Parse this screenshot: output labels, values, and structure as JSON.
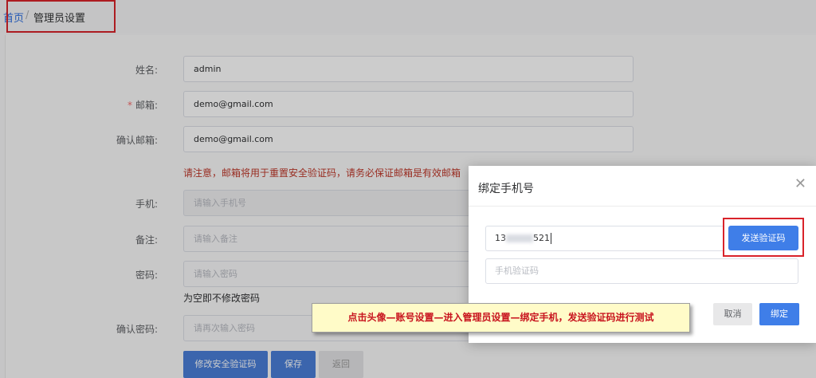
{
  "breadcrumb": {
    "home": "首页",
    "separator": "/",
    "current": "管理员设置"
  },
  "form": {
    "name_label": "姓名:",
    "name_value": "admin",
    "email_star": "*",
    "email_label": "邮箱:",
    "email_value": "demo@gmail.com",
    "confirm_email_label": "确认邮箱:",
    "confirm_email_value": "demo@gmail.com",
    "email_notice": "请注意，邮箱将用于重置安全验证码，请务必保证邮箱是有效邮箱",
    "phone_label": "手机:",
    "phone_placeholder": "请输入手机号",
    "remark_label": "备注:",
    "remark_placeholder": "请输入备注",
    "password_label": "密码:",
    "password_placeholder": "请输入密码",
    "password_hint": "为空即不修改密码",
    "confirm_password_label": "确认密码:",
    "confirm_password_placeholder": "请再次输入密码",
    "buttons": {
      "change_code": "修改安全验证码",
      "save": "保存",
      "back": "返回"
    }
  },
  "dialog": {
    "title": "绑定手机号",
    "close_icon": "close-icon",
    "phone_prefix": "13",
    "phone_suffix": "521",
    "send_code": "发送验证码",
    "code_placeholder": "手机验证码",
    "cancel": "取消",
    "confirm": "绑定"
  },
  "annotation": "点击头像—账号设置—进入管理员设置—绑定手机，发送验证码进行测试",
  "colors": {
    "primary": "#3f7ee8",
    "highlight": "#d9232a",
    "warning": "#c0392b",
    "callout_bg": "#fffbc8"
  }
}
